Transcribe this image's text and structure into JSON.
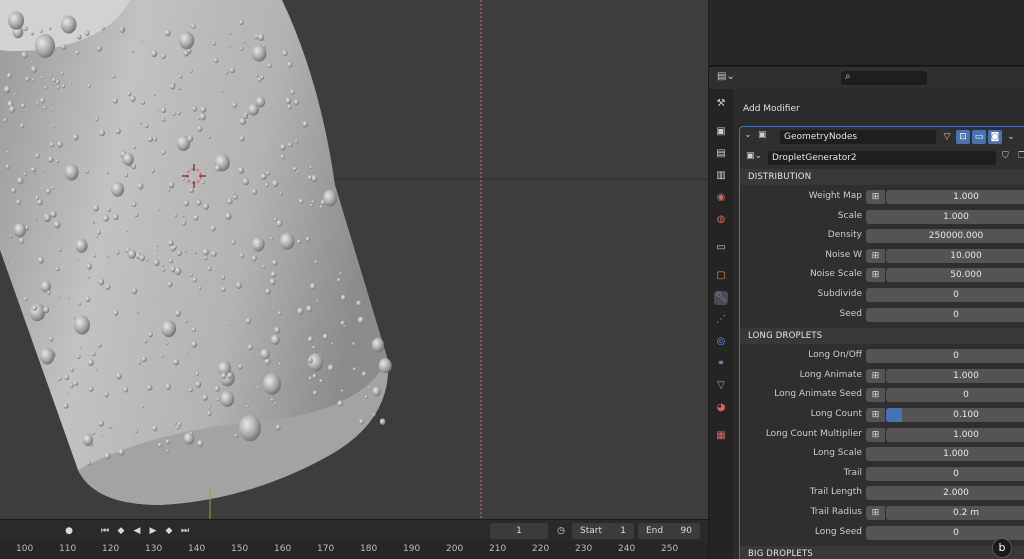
{
  "timeline": {
    "current_frame": "1",
    "start_label": "Start",
    "start_value": "1",
    "end_label": "End",
    "end_value": "90",
    "ruler": [
      "100",
      "110",
      "120",
      "130",
      "140",
      "150",
      "160",
      "170",
      "180",
      "190",
      "200",
      "210",
      "220",
      "230",
      "240",
      "250"
    ]
  },
  "properties": {
    "add_modifier_label": "Add Modifier",
    "modifier_name": "GeometryNodes",
    "node_group_name": "DropletGenerator2",
    "sections": [
      {
        "title": "DISTRIBUTION",
        "rows": [
          {
            "label": "Weight Map",
            "value": "1.000",
            "attr": true
          },
          {
            "label": "Scale",
            "value": "1.000",
            "attr": false
          },
          {
            "label": "Density",
            "value": "250000.000",
            "attr": false
          },
          {
            "label": "Noise W",
            "value": "10.000",
            "attr": true
          },
          {
            "label": "Noise Scale",
            "value": "50.000",
            "attr": true
          },
          {
            "label": "Subdivide",
            "value": "0",
            "attr": false
          },
          {
            "label": "Seed",
            "value": "0",
            "attr": false
          }
        ]
      },
      {
        "title": "LONG DROPLETS",
        "rows": [
          {
            "label": "Long On/Off",
            "value": "0",
            "attr": false
          },
          {
            "label": "Long Animate",
            "value": "1.000",
            "attr": true
          },
          {
            "label": "Long Animate Seed",
            "value": "0",
            "attr": true
          },
          {
            "label": "Long Count",
            "value": "0.100",
            "attr": true,
            "fill": 0.1
          },
          {
            "label": "Long Count Multiplier",
            "value": "1.000",
            "attr": true
          },
          {
            "label": "Long Scale",
            "value": "1.000",
            "attr": false
          },
          {
            "label": "Trail",
            "value": "0",
            "attr": false
          },
          {
            "label": "Trail Length",
            "value": "2.000",
            "attr": false
          },
          {
            "label": "Trail Radius",
            "value": "0.2 m",
            "attr": true
          },
          {
            "label": "Long Seed",
            "value": "0",
            "attr": false
          }
        ]
      },
      {
        "title": "BIG DROPLETS",
        "rows": []
      }
    ]
  },
  "colors": {
    "accent": "#4772b3",
    "viewport_bg": "#3d3d3d",
    "panel_bg": "#2b2b2b"
  },
  "icons": {
    "search": "search-icon",
    "wrench": "wrench-icon",
    "close": "close-icon"
  }
}
